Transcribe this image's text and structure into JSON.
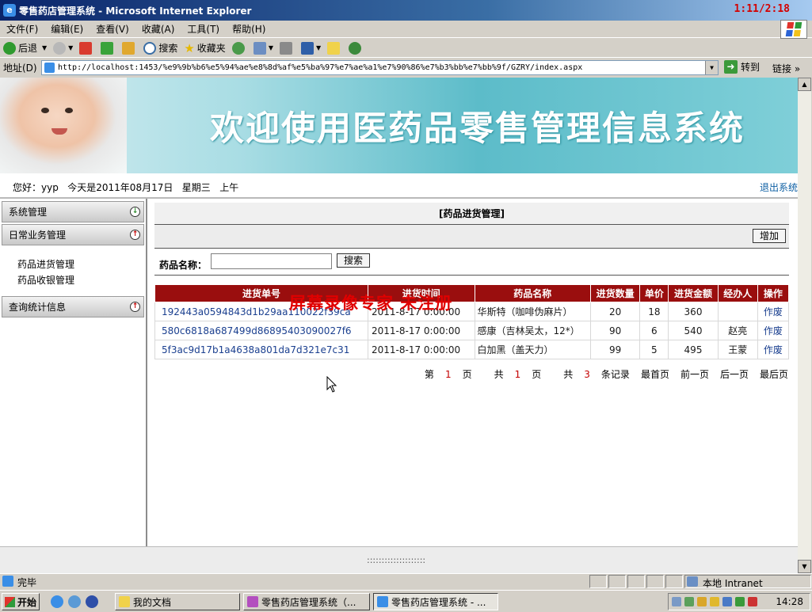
{
  "window": {
    "title": "零售药店管理系统 - Microsoft Internet Explorer",
    "clock": "1:11/2:18"
  },
  "menu": [
    "文件(F)",
    "编辑(E)",
    "查看(V)",
    "收藏(A)",
    "工具(T)",
    "帮助(H)"
  ],
  "toolbar": {
    "back": "后退",
    "search": "搜索",
    "favorites": "收藏夹"
  },
  "address": {
    "label": "地址(D)",
    "url": "http://localhost:1453/%e9%9b%b6%e5%94%ae%e8%8d%af%e5%ba%97%e7%ae%a1%e7%90%86%e7%b3%bb%e7%bb%9f/GZRY/index.aspx",
    "go": "转到",
    "links": "链接"
  },
  "banner": {
    "title": "欢迎使用医药品零售管理信息系统"
  },
  "greeting": {
    "text": "您好：yyp   今天是2011年08月17日   星期三   上午",
    "logout": "退出系统"
  },
  "sidebar": {
    "sections": [
      {
        "label": "系统管理",
        "state": "+"
      },
      {
        "label": "日常业务管理",
        "state": "-"
      },
      {
        "label": "查询统计信息",
        "state": "-"
      }
    ],
    "items": [
      "药品进货管理",
      "药品收银管理"
    ]
  },
  "panel": {
    "title": "[药品进货管理]",
    "add": "增加",
    "search_label": "药品名称：",
    "search_value": "",
    "search_button": "搜索"
  },
  "table": {
    "headers": [
      "进货单号",
      "进货时间",
      "药品名称",
      "进货数量",
      "单价",
      "进货金额",
      "经办人",
      "操作"
    ],
    "rows": [
      [
        "192443a0594843d1b29aa110022f39ca",
        "2011-8-17 0:00:00",
        "华斯特（咖啡伪麻片）",
        "20",
        "18",
        "360",
        "",
        "作废"
      ],
      [
        "580c6818a687499d86895403090027f6",
        "2011-8-17 0:00:00",
        "感康（吉林吴太，12*）",
        "90",
        "6",
        "540",
        "赵亮",
        "作废"
      ],
      [
        "5f3ac9d17b1a4638a801da7d321e7c31",
        "2011-8-17 0:00:00",
        "白加黑（盖天力）",
        "99",
        "5",
        "495",
        "王蒙",
        "作废"
      ]
    ]
  },
  "pager": {
    "page_prefix": "第",
    "page_num": "1",
    "page_suffix": "页",
    "total_prefix": "共",
    "total_num": "1",
    "total_suffix": "页",
    "rec_prefix": "共",
    "rec_num": "3",
    "rec_suffix": "条记录",
    "first": "最首页",
    "prev": "前一页",
    "next": "后一页",
    "last": "最后页"
  },
  "watermark": "屏幕录像专家  未注册",
  "hbar": "::::::::::::::::::::",
  "status": {
    "text": "完毕",
    "zone": "本地 Intranet"
  },
  "taskbar": {
    "start": "开始",
    "tasks": [
      "我的文档",
      "零售药店管理系统（...",
      "零售药店管理系统 - ..."
    ],
    "time": "14:28"
  },
  "colors": {
    "header_red": "#9a0e0e",
    "link_blue": "#1a3f8f",
    "banner_teal": "#5cbcc9"
  }
}
